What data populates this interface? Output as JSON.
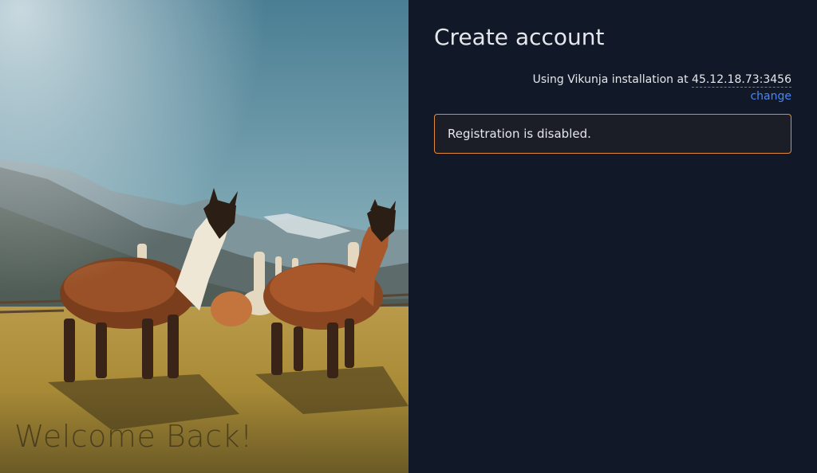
{
  "hero": {
    "image_alt": "llamas-photo",
    "welcome_text": "Welcome Back!"
  },
  "form": {
    "title": "Create account",
    "install_prefix": "Using Vikunja installation at",
    "install_url": "45.12.18.73:3456",
    "change_label": "change",
    "notice_text": "Registration is disabled."
  },
  "colors": {
    "background": "#111827",
    "link": "#4a86f0",
    "notice_border": "#e3893c"
  }
}
